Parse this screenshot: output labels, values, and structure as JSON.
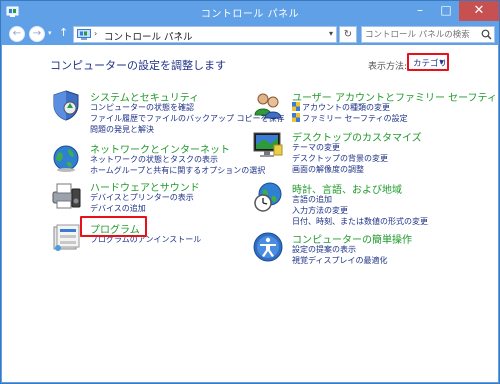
{
  "window": {
    "title": "コントロール パネル",
    "buttons": {
      "minimize": "–",
      "maximize": "□",
      "close": "✕"
    }
  },
  "nav": {
    "back": "←",
    "forward": "→",
    "up": "↑",
    "breadcrumb": "コントロール パネル",
    "refresh": "↻",
    "search_placeholder": "コントロール パネルの検索"
  },
  "main": {
    "heading": "コンピューターの設定を調整します",
    "view_by_label": "表示方法:",
    "view_by_value": "カテゴリ"
  },
  "categories_left": [
    {
      "title": "システムとセキュリティ",
      "icon": "shield-icon",
      "links": [
        "コンピューターの状態を確認",
        "ファイル履歴でファイルのバックアップ コピーを保存",
        "問題の発見と解決"
      ]
    },
    {
      "title": "ネットワークとインターネット",
      "icon": "network-globe-icon",
      "links": [
        "ネットワークの状態とタスクの表示",
        "ホームグループと共有に関するオプションの選択"
      ]
    },
    {
      "title": "ハードウェアとサウンド",
      "icon": "printer-speaker-icon",
      "links": [
        "デバイスとプリンターの表示",
        "デバイスの追加"
      ]
    },
    {
      "title": "プログラム",
      "icon": "programs-icon",
      "links": [
        "プログラムのアンインストール"
      ]
    }
  ],
  "categories_right": [
    {
      "title": "ユーザー アカウントとファミリー セーフティ",
      "icon": "users-icon",
      "links": [
        "アカウントの種類の変更",
        "ファミリー セーフティの設定"
      ]
    },
    {
      "title": "デスクトップのカスタマイズ",
      "icon": "desktop-icon",
      "links": [
        "テーマの変更",
        "デスクトップの背景の変更",
        "画面の解像度の調整"
      ]
    },
    {
      "title": "時計、言語、および地域",
      "icon": "clock-globe-icon",
      "links": [
        "言語の追加",
        "入力方法の変更",
        "日付、時刻、または数値の形式の変更"
      ]
    },
    {
      "title": "コンピューターの簡単操作",
      "icon": "ease-of-access-icon",
      "links": [
        "設定の提案の表示",
        "視覚ディスプレイの最適化"
      ]
    }
  ],
  "colors": {
    "accent": "#5fa0e6",
    "category_title": "#1e9a2a",
    "link": "#1e3287",
    "highlight": "#e8101a"
  }
}
